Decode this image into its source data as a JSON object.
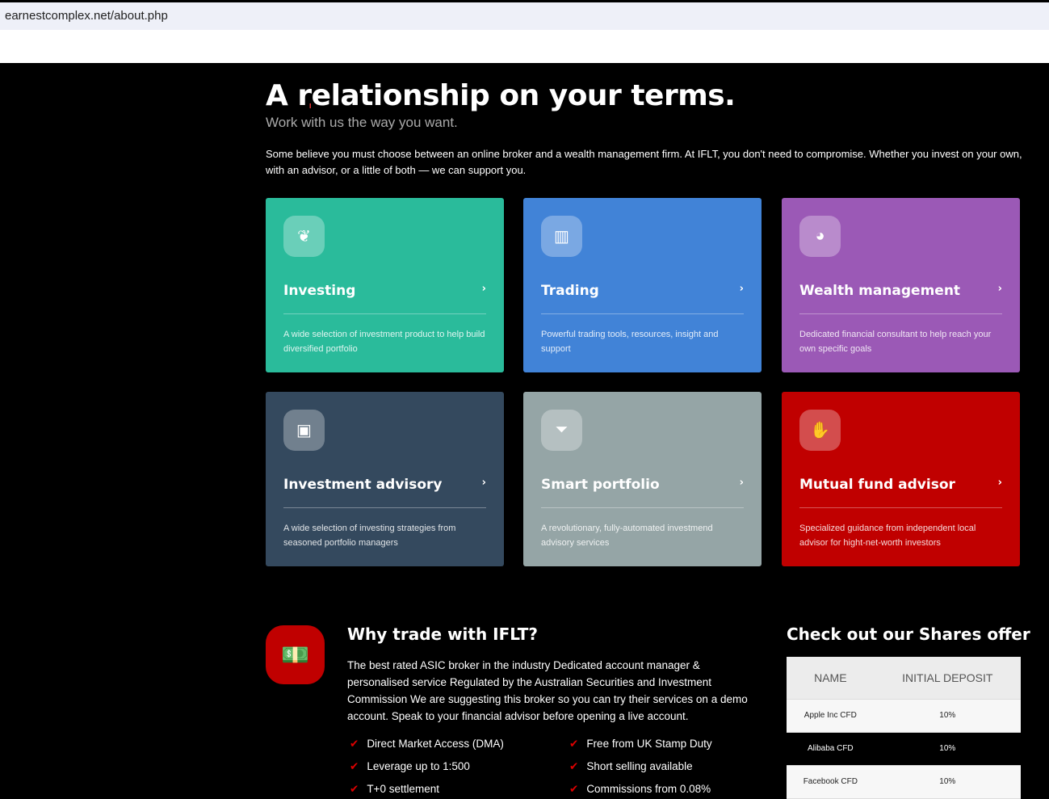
{
  "browser": {
    "url": "earnestcomplex.net/about.php"
  },
  "hero": {
    "title_pre": "A ",
    "title_highlight": "relationship",
    "title_post": " on your terms.",
    "subtitle": "Work with us the way you want.",
    "intro": "Some believe you must choose between an online broker and a wealth management firm. At IFLT, you don't need to compromise. Whether you invest on your own, with an advisor, or a little of both — we can support you."
  },
  "cards": [
    {
      "title": "Investing",
      "desc": "A wide selection of investment product to help build diversified portfolio",
      "color": "#2abb9b",
      "icon": "sprout-icon"
    },
    {
      "title": "Trading",
      "desc": "Powerful trading tools, resources, insight and support",
      "color": "#4183d7",
      "icon": "bar-chart-icon"
    },
    {
      "title": "Wealth management",
      "desc": "Dedicated financial consultant to help reach your own specific goals",
      "color": "#9b59b6",
      "icon": "pie-chart-icon"
    },
    {
      "title": "Investment advisory",
      "desc": "A wide selection of investing strategies from seasoned portfolio managers",
      "color": "#34495e",
      "icon": "advisor-icon"
    },
    {
      "title": "Smart portfolio",
      "desc": "A revolutionary, fully-automated investmend advisory services",
      "color": "#95a5a6",
      "icon": "funnel-dollar-icon"
    },
    {
      "title": "Mutual fund advisor",
      "desc": "Specialized guidance from independent local advisor for hight-net-worth investors",
      "color": "#c00000",
      "icon": "handshake-icon"
    }
  ],
  "why": {
    "title": "Why trade with IFLT?",
    "text": "The best rated ASIC broker in the industry Dedicated account manager & personalised service Regulated by the Australian Securities and Investment Commission We are suggesting this broker so you can try their services on a demo account. Speak to your financial advisor before opening a live account.",
    "features": [
      "Direct Market Access (DMA)",
      "Free from UK Stamp Duty",
      "Leverage up to 1:500",
      "Short selling available",
      "T+0 settlement",
      "Commissions from 0.08%"
    ]
  },
  "shares": {
    "title": "Check out our Shares offer",
    "headers": [
      "NAME",
      "INITIAL DEPOSIT"
    ],
    "rows": [
      [
        "Apple Inc CFD",
        "10%"
      ],
      [
        "Alibaba CFD",
        "10%"
      ],
      [
        "Facebook CFD",
        "10%"
      ]
    ]
  }
}
